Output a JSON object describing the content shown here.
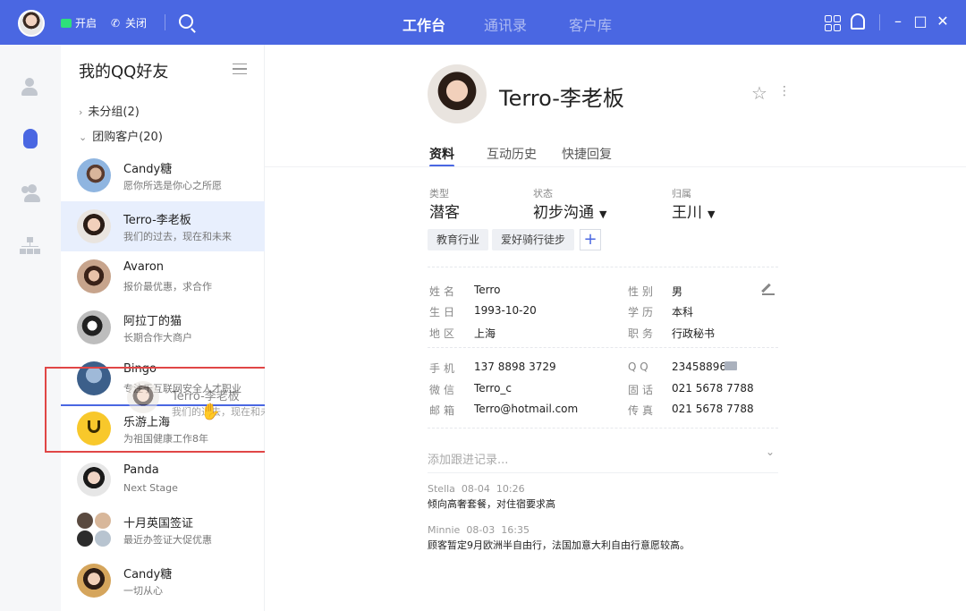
{
  "topbar": {
    "status_on": "开启",
    "status_off": "关闭",
    "tabs": [
      "工作台",
      "通讯录",
      "客户库"
    ],
    "active_tab": 0,
    "icons": [
      "avatar",
      "status-on-icon",
      "phone-icon",
      "search-icon",
      "grid-icon",
      "bell-icon",
      "minimize-icon",
      "maximize-icon",
      "close-icon"
    ]
  },
  "window_controls": {
    "minimize": "–",
    "maximize": "□",
    "close": "✕"
  },
  "friends_panel": {
    "title": "我的QQ好友",
    "groups": [
      {
        "label": "未分组(2)",
        "chevron": "›"
      },
      {
        "label": "团购客户(20)",
        "chevron": "⌄"
      }
    ],
    "friends": [
      {
        "name": "Candy糖",
        "sub": "愿你所选是你心之所愿"
      },
      {
        "name": "Terro-李老板",
        "sub": "我们的过去，现在和未来"
      },
      {
        "name": "Avaron",
        "sub": "报价最优惠，求合作"
      },
      {
        "name": "阿拉丁的猫",
        "sub": "长期合作大商户"
      },
      {
        "name": "Bingo",
        "sub": "专注于互联网安全人才职业"
      },
      {
        "name": "乐游上海",
        "sub": "为祖国健康工作8年"
      },
      {
        "name": "Panda",
        "sub": "Next Stage"
      },
      {
        "name": "十月英国签证",
        "sub": "最近办签证大促优惠"
      },
      {
        "name": "Candy糖",
        "sub": "一切从心"
      }
    ],
    "selected_index": 1,
    "drag_ghost": {
      "name": "Terro-李老板",
      "sub": "我们的过去，现在和未来"
    }
  },
  "detail": {
    "name": "Terro-李老板",
    "tabs": [
      "资料",
      "互动历史",
      "快捷回复"
    ],
    "active_tab": 0,
    "fields": {
      "type_label": "类型",
      "type_value": "潜客",
      "status_label": "状态",
      "status_value": "初步沟通",
      "owner_label": "归属",
      "owner_value": "王川"
    },
    "tags": [
      "教育行业",
      "爱好骑行徒步"
    ],
    "tag_add": "+",
    "info_left": [
      {
        "label": "姓名",
        "value": "Terro"
      },
      {
        "label": "生日",
        "value": "1993-10-20"
      },
      {
        "label": "地区",
        "value": "上海"
      }
    ],
    "info_right": [
      {
        "label": "性别",
        "value": "男"
      },
      {
        "label": "学历",
        "value": "本科"
      },
      {
        "label": "职务",
        "value": "行政秘书"
      }
    ],
    "contact_left": [
      {
        "label": "手机",
        "value": "137 8898 3729"
      },
      {
        "label": "微信",
        "value": "Terro_c"
      },
      {
        "label": "邮箱",
        "value": "Terro@hotmail.com"
      }
    ],
    "contact_right": [
      {
        "label": "Q Q",
        "value": "23458896"
      },
      {
        "label": "固话",
        "value": "021 5678 7788"
      },
      {
        "label": "传真",
        "value": "021 5678 7788"
      }
    ],
    "add_note_placeholder": "添加跟进记录...",
    "notes": [
      {
        "author": "Stella",
        "date": "08-04",
        "time": "10:26",
        "text": "倾向高奢套餐，对住宿要求高"
      },
      {
        "author": "Minnie",
        "date": "08-03",
        "time": "16:35",
        "text": "顾客暂定9月欧洲半自由行，法国加意大利自由行意愿较高。"
      }
    ]
  },
  "colors": {
    "accent": "#4a67e2",
    "selected_row": "#e8effd",
    "drag_box": "#e04646"
  }
}
